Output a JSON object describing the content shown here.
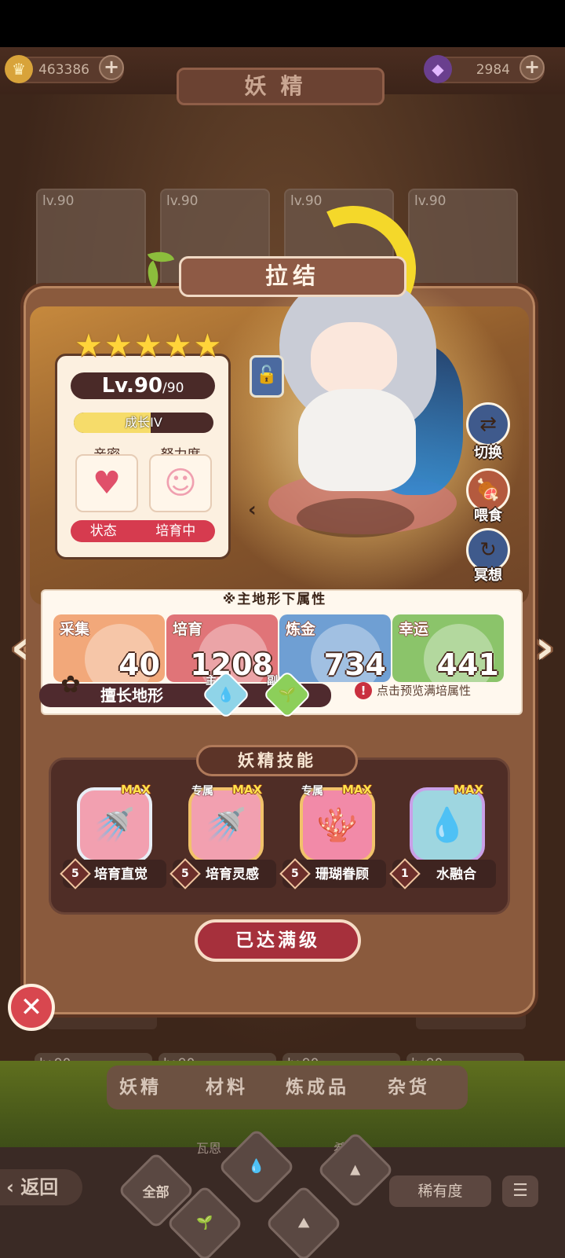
{
  "currency": {
    "gold": "463386",
    "gems": "2984",
    "plus": "+"
  },
  "page": {
    "title": "妖精"
  },
  "background": {
    "cards": [
      {
        "level": "lv.90"
      },
      {
        "level": "lv.90"
      },
      {
        "level": "lv.90"
      },
      {
        "level": "lv.90"
      }
    ],
    "lower_cards": [
      {
        "level": "lv.90"
      },
      {
        "level": "lv.90"
      },
      {
        "level": "lv.90"
      },
      {
        "level": "lv.90"
      }
    ]
  },
  "fairy": {
    "name": "拉结",
    "stars": 5,
    "level": "Lv.90",
    "max_level": "/90",
    "growth_label": "成长IV",
    "growth_progress": 0.55,
    "intimacy_label": "亲密",
    "effort_label": "努力度",
    "status_label": "状态",
    "status_value": "培育中"
  },
  "actions": {
    "switch": "切换",
    "feed": "喂食",
    "meditate": "冥想"
  },
  "attributes": {
    "note": "※主地形下属性",
    "items": [
      {
        "name": "采集",
        "value": "40",
        "color": "#f2a87a"
      },
      {
        "name": "培育",
        "value": "1208",
        "color": "#e07478"
      },
      {
        "name": "炼金",
        "value": "734",
        "color": "#6f9fd3"
      },
      {
        "name": "幸运",
        "value": "441",
        "color": "#8bc46a"
      }
    ],
    "terrain_label": "擅长地形",
    "terrain_main_tag": "主",
    "terrain_sub_tag": "副",
    "preview_hint": "点击预览满培属性"
  },
  "skills": {
    "title": "妖精技能",
    "max_tag": "MAX",
    "exclusive_tag": "专属",
    "items": [
      {
        "name": "培育直觉",
        "level": "5",
        "exclusive": false
      },
      {
        "name": "培育灵感",
        "level": "5",
        "exclusive": true
      },
      {
        "name": "珊瑚眷顾",
        "level": "5",
        "exclusive": true
      },
      {
        "name": "水融合",
        "level": "1",
        "exclusive": false
      }
    ]
  },
  "max_button": "已达满级",
  "bottom": {
    "tabs": [
      "妖精",
      "材料",
      "炼成品",
      "杂货"
    ],
    "back": "返回",
    "filter_all": "全部",
    "rarity": "稀有度",
    "name_a": "瓦恩",
    "name_b": "希"
  }
}
